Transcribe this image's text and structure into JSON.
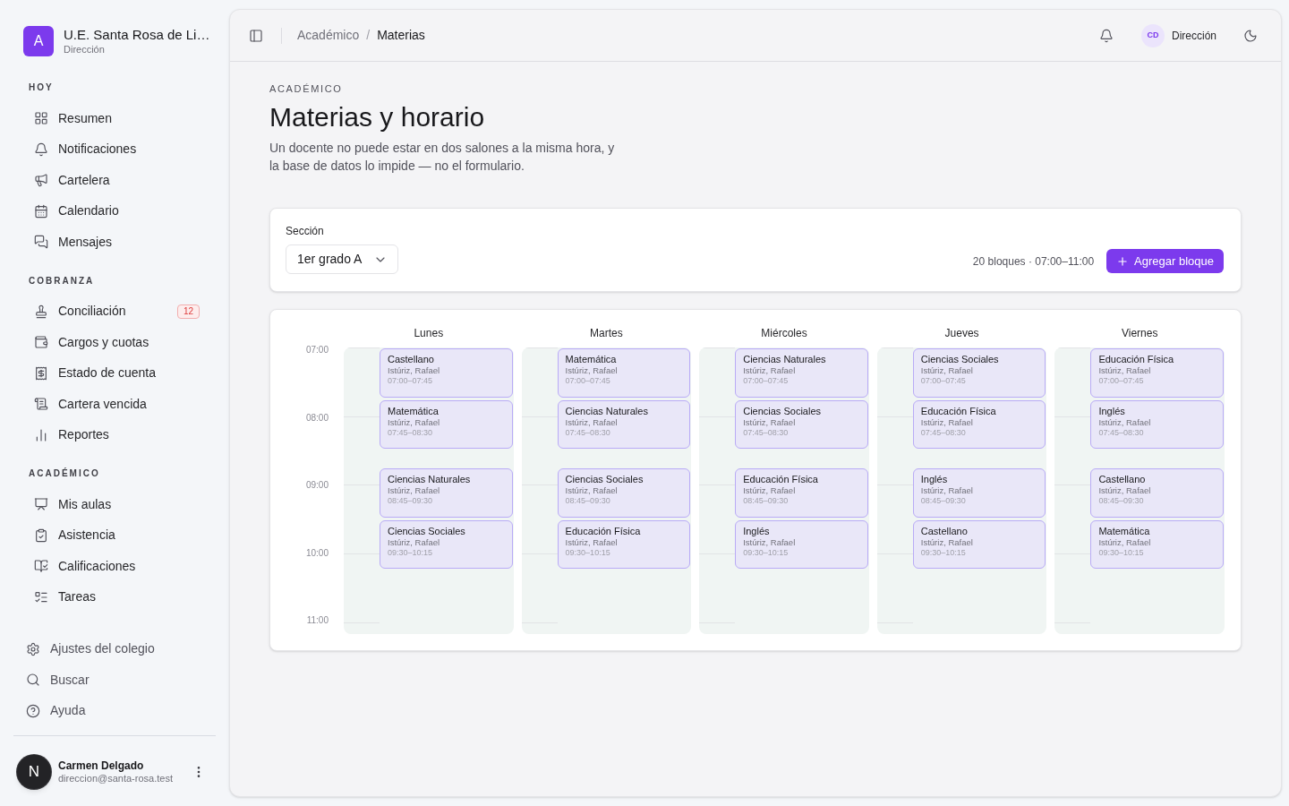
{
  "sidebar": {
    "brand": {
      "logo_letter": "A",
      "name": "U.E. Santa Rosa de Li…",
      "role": "Dirección"
    },
    "sections": [
      {
        "title": "HOY",
        "items": [
          {
            "label": "Resumen",
            "selected": false
          },
          {
            "label": "Notificaciones",
            "selected": false
          },
          {
            "label": "Cartelera",
            "selected": false
          },
          {
            "label": "Calendario",
            "selected": false
          },
          {
            "label": "Mensajes",
            "selected": false
          }
        ]
      },
      {
        "title": "COBRANZA",
        "items": [
          {
            "label": "Conciliación",
            "selected": false,
            "badge": "12"
          },
          {
            "label": "Cargos y cuotas",
            "selected": false
          },
          {
            "label": "Estado de cuenta",
            "selected": false
          },
          {
            "label": "Cartera vencida",
            "selected": false
          },
          {
            "label": "Reportes",
            "selected": false
          }
        ]
      },
      {
        "title": "ACADÉMICO",
        "items": [
          {
            "label": "Mis aulas",
            "selected": false
          },
          {
            "label": "Asistencia",
            "selected": false
          },
          {
            "label": "Calificaciones",
            "selected": false
          },
          {
            "label": "Tareas",
            "selected": false
          }
        ]
      }
    ],
    "footer_items": [
      {
        "label": "Ajustes del colegio"
      },
      {
        "label": "Buscar"
      },
      {
        "label": "Ayuda"
      }
    ],
    "user": {
      "avatar_letter": "N",
      "name": "Carmen Delgado",
      "email": "direccion@santa-rosa.test"
    }
  },
  "header": {
    "breadcrumb": {
      "parent": "Académico",
      "separator": "/",
      "current": "Materias"
    },
    "user": {
      "initials": "CD",
      "role": "Dirección"
    }
  },
  "page": {
    "eyebrow": "ACADÉMICO",
    "title": "Materias y horario",
    "description": "Un docente no puede estar en dos salones a la misma hora, y la base de datos lo impide — no el formulario."
  },
  "toolbar": {
    "section_label": "Sección",
    "section_value": "1er grado A",
    "summary": "20 bloques · 07:00–11:00",
    "add_button": "Agregar bloque"
  },
  "schedule": {
    "hours": [
      "07:00",
      "08:00",
      "09:00",
      "10:00",
      "11:00"
    ],
    "days": [
      {
        "name": "Lunes",
        "blocks": [
          {
            "subject": "Castellano",
            "teacher": "Istúriz, Rafael",
            "time": "07:00–07:45"
          },
          {
            "subject": "Matemática",
            "teacher": "Istúriz, Rafael",
            "time": "07:45–08:30"
          },
          {
            "subject": "Ciencias Naturales",
            "teacher": "Istúriz, Rafael",
            "time": "08:45–09:30"
          },
          {
            "subject": "Ciencias Sociales",
            "teacher": "Istúriz, Rafael",
            "time": "09:30–10:15"
          }
        ]
      },
      {
        "name": "Martes",
        "blocks": [
          {
            "subject": "Matemática",
            "teacher": "Istúriz, Rafael",
            "time": "07:00–07:45"
          },
          {
            "subject": "Ciencias Naturales",
            "teacher": "Istúriz, Rafael",
            "time": "07:45–08:30"
          },
          {
            "subject": "Ciencias Sociales",
            "teacher": "Istúriz, Rafael",
            "time": "08:45–09:30"
          },
          {
            "subject": "Educación Física",
            "teacher": "Istúriz, Rafael",
            "time": "09:30–10:15"
          }
        ]
      },
      {
        "name": "Miércoles",
        "blocks": [
          {
            "subject": "Ciencias Naturales",
            "teacher": "Istúriz, Rafael",
            "time": "07:00–07:45"
          },
          {
            "subject": "Ciencias Sociales",
            "teacher": "Istúriz, Rafael",
            "time": "07:45–08:30"
          },
          {
            "subject": "Educación Física",
            "teacher": "Istúriz, Rafael",
            "time": "08:45–09:30"
          },
          {
            "subject": "Inglés",
            "teacher": "Istúriz, Rafael",
            "time": "09:30–10:15"
          }
        ]
      },
      {
        "name": "Jueves",
        "blocks": [
          {
            "subject": "Ciencias Sociales",
            "teacher": "Istúriz, Rafael",
            "time": "07:00–07:45"
          },
          {
            "subject": "Educación Física",
            "teacher": "Istúriz, Rafael",
            "time": "07:45–08:30"
          },
          {
            "subject": "Inglés",
            "teacher": "Istúriz, Rafael",
            "time": "08:45–09:30"
          },
          {
            "subject": "Castellano",
            "teacher": "Istúriz, Rafael",
            "time": "09:30–10:15"
          }
        ]
      },
      {
        "name": "Viernes",
        "blocks": [
          {
            "subject": "Educación Física",
            "teacher": "Istúriz, Rafael",
            "time": "07:00–07:45"
          },
          {
            "subject": "Inglés",
            "teacher": "Istúriz, Rafael",
            "time": "07:45–08:30"
          },
          {
            "subject": "Castellano",
            "teacher": "Istúriz, Rafael",
            "time": "08:45–09:30"
          },
          {
            "subject": "Matemática",
            "teacher": "Istúriz, Rafael",
            "time": "09:30–10:15"
          }
        ]
      }
    ]
  }
}
